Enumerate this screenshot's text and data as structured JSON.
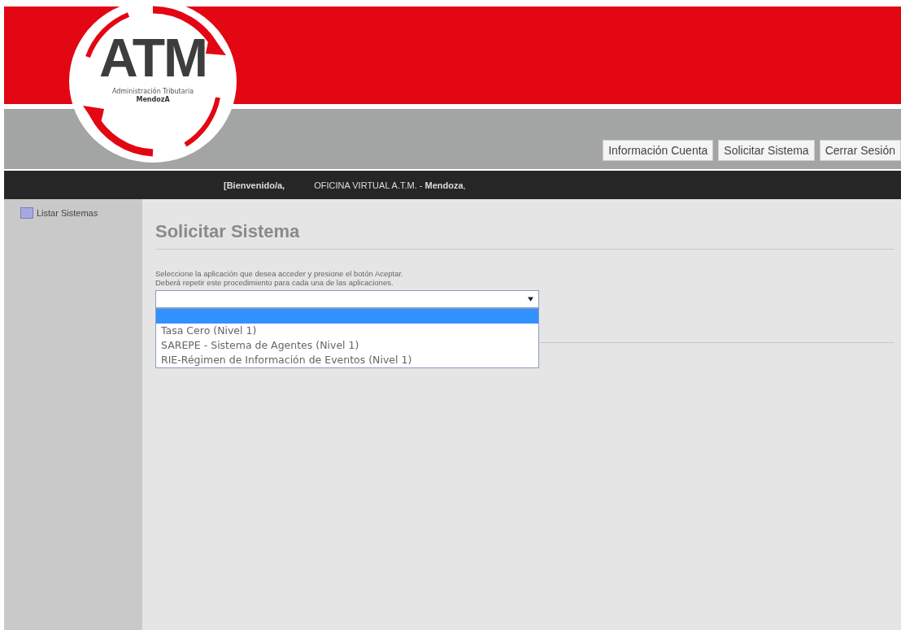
{
  "logo": {
    "title": "ATM",
    "subtitle": "Administración Tributaria",
    "region": "MendozA"
  },
  "nav_buttons": [
    "Información Cuenta",
    "Solicitar Sistema",
    "Cerrar Sesión"
  ],
  "welcome_bar": {
    "greeting": "[Bienvenido/a,",
    "office": "OFICINA VIRTUAL A.T.M. - **Mendoza**,"
  },
  "sidebar": {
    "items": [
      {
        "label": "Listar Sistemas"
      }
    ]
  },
  "content": {
    "heading": "Solicitar Sistema",
    "instructions": [
      "Seleccione la aplicación que desea acceder y presione el botón Aceptar.",
      "Deberá repetir este procedimiento para cada una de las aplicaciones."
    ],
    "dropdown": {
      "expanded": true,
      "options": [
        {
          "selected": true
        },
        {
          "label": "Tasa Cero (Nivel 1)",
          "selected": false
        },
        {
          "label": "SAREPE - Sistema de Agentes (Nivel 1)",
          "selected": false
        },
        {
          "label": "RIE-Régimen de Información de Eventos (Nivel 1)",
          "selected": false
        }
      ]
    }
  }
}
